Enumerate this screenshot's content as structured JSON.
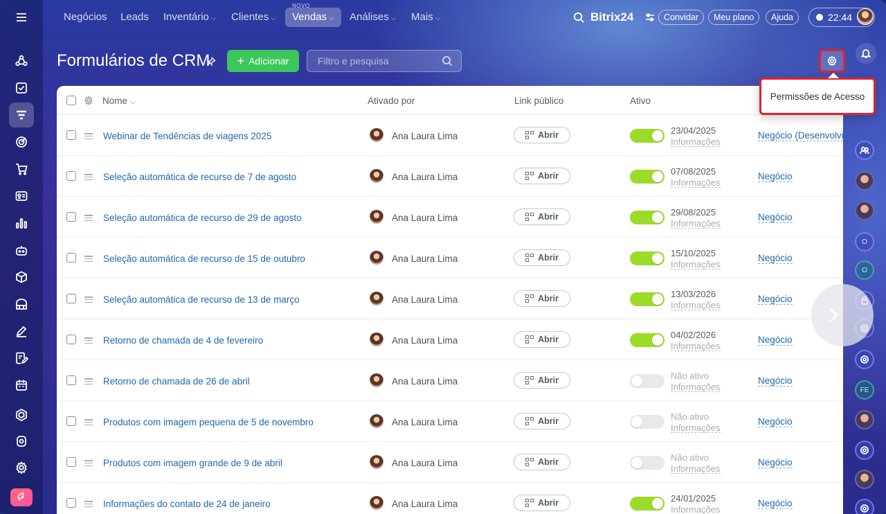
{
  "topnav": {
    "items": [
      {
        "label": "Negócios",
        "chevron": ""
      },
      {
        "label": "Leads",
        "chevron": ""
      },
      {
        "label": "Inventário",
        "chevron": "⌵"
      },
      {
        "label": "Clientes",
        "chevron": "⌵"
      },
      {
        "label": "Vendas",
        "chevron": "⌵"
      },
      {
        "label": "Análises",
        "chevron": "⌵"
      },
      {
        "label": "Mais",
        "chevron": "⌵"
      }
    ],
    "novo_badge": "NOVO",
    "brand": "Bitrix24",
    "invite_label": "Convidar",
    "plan_label": "Meu plano",
    "help_label": "Ajuda",
    "time": "22:44"
  },
  "header": {
    "title": "Formulários de CRM",
    "add_label": "Adicionar",
    "search_placeholder": "Filtro e pesquisa"
  },
  "popup": {
    "label": "Permissões de Acesso"
  },
  "table": {
    "columns": {
      "name": "Nome",
      "activated_by": "Ativado por",
      "public_link": "Link público",
      "active": "Ativo"
    },
    "open_label": "Abrir",
    "info_label": "Informações",
    "rows": [
      {
        "name": "Webinar de Tendências de viagens 2025",
        "user": "Ana Laura Lima",
        "active": true,
        "status": "23/04/2025",
        "entity": "Negócio (Desenvolvi"
      },
      {
        "name": "Seleção automática de recurso de 7 de agosto",
        "user": "Ana Laura Lima",
        "active": true,
        "status": "07/08/2025",
        "entity": "Negócio"
      },
      {
        "name": "Seleção automática de recurso de 29 de agosto",
        "user": "Ana Laura Lima",
        "active": true,
        "status": "29/08/2025",
        "entity": "Negócio"
      },
      {
        "name": "Seleção automática de recurso de 15 de outubro",
        "user": "Ana Laura Lima",
        "active": true,
        "status": "15/10/2025",
        "entity": "Negócio"
      },
      {
        "name": "Seleção automática de recurso de 13 de março",
        "user": "Ana Laura Lima",
        "active": true,
        "status": "13/03/2026",
        "entity": "Negócio"
      },
      {
        "name": "Retorno de chamada de 4 de fevereiro",
        "user": "Ana Laura Lima",
        "active": true,
        "status": "04/02/2026",
        "entity": "Negócio"
      },
      {
        "name": "Retorno de chamada de 26 de abril",
        "user": "Ana Laura Lima",
        "active": false,
        "status": "Não ativo",
        "entity": "Negócio"
      },
      {
        "name": "Produtos com imagem pequena de 5 de novembro",
        "user": "Ana Laura Lima",
        "active": false,
        "status": "Não ativo",
        "entity": "Negócio"
      },
      {
        "name": "Produtos com imagem grande de 9 de abril",
        "user": "Ana Laura Lima",
        "active": false,
        "status": "Não ativo",
        "entity": "Negócio"
      },
      {
        "name": "Informações do contato de 24 de janeiro",
        "user": "Ana Laura Lima",
        "active": true,
        "status": "24/01/2025",
        "entity": "Negócio"
      }
    ]
  },
  "rightbar": {
    "initials": [
      "O",
      "O",
      "FE"
    ]
  },
  "colors": {
    "accent_green": "#3bc75a",
    "toggle_on": "#9bdc28",
    "link_blue": "#2067b0",
    "highlight_red": "#e8202a"
  }
}
